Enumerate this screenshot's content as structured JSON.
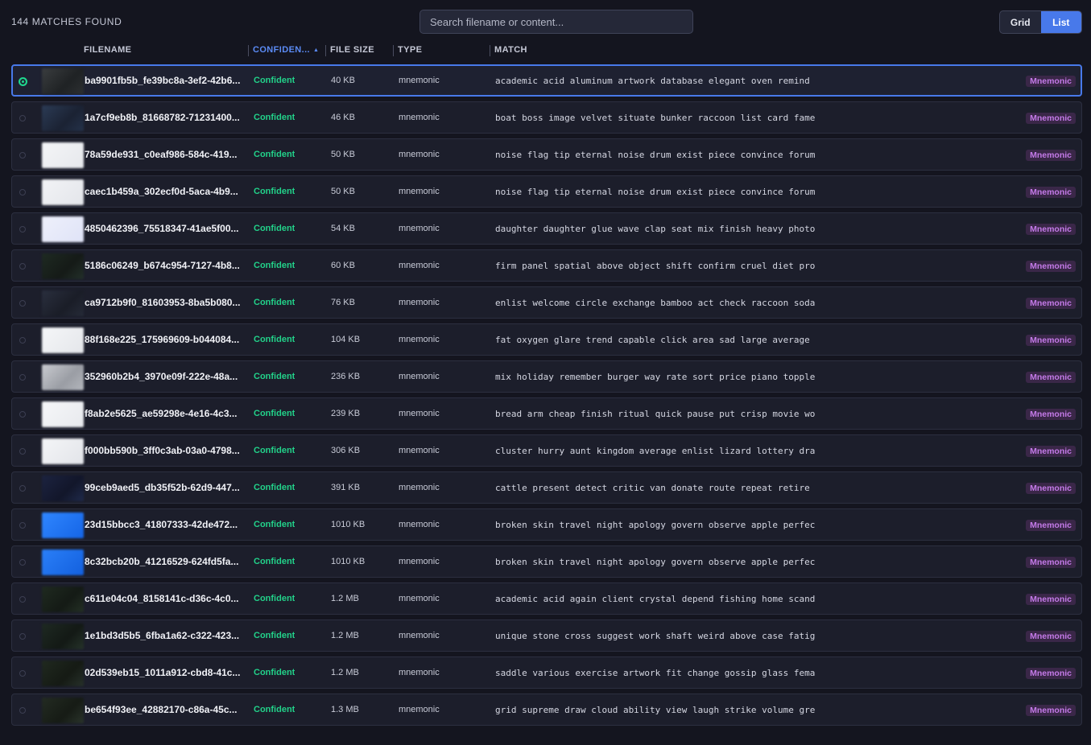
{
  "header": {
    "matches_found": "144 MATCHES FOUND",
    "search_placeholder": "Search filename or content...",
    "view_grid": "Grid",
    "view_list": "List",
    "active_view": "List"
  },
  "columns": {
    "filename": "FILENAME",
    "confidence": "CONFIDEN...",
    "file_size": "FILE SIZE",
    "type": "TYPE",
    "match": "MATCH"
  },
  "colors": {
    "accent": "#4879ea",
    "confident": "#22d28a",
    "badge_bg": "#3a2748",
    "badge_text": "#c47ae8"
  },
  "rows": [
    {
      "filename": "ba9901fb5b_fe39bc8a-3ef2-42b6...",
      "confidence": "Confident",
      "size": "40 KB",
      "type": "mnemonic",
      "match": "academic acid aluminum artwork database elegant oven remind",
      "badge": "Mnemonic",
      "selected": true
    },
    {
      "filename": "1a7cf9eb8b_81668782-71231400...",
      "confidence": "Confident",
      "size": "46 KB",
      "type": "mnemonic",
      "match": "boat boss image velvet situate bunker raccoon list card fame",
      "badge": "Mnemonic"
    },
    {
      "filename": "78a59de931_c0eaf986-584c-419...",
      "confidence": "Confident",
      "size": "50 KB",
      "type": "mnemonic",
      "match": "noise flag tip eternal noise drum exist piece convince forum",
      "badge": "Mnemonic"
    },
    {
      "filename": "caec1b459a_302ecf0d-5aca-4b9...",
      "confidence": "Confident",
      "size": "50 KB",
      "type": "mnemonic",
      "match": "noise flag tip eternal noise drum exist piece convince forum",
      "badge": "Mnemonic"
    },
    {
      "filename": "4850462396_75518347-41ae5f00...",
      "confidence": "Confident",
      "size": "54 KB",
      "type": "mnemonic",
      "match": "daughter daughter glue wave clap seat mix finish heavy photo",
      "badge": "Mnemonic"
    },
    {
      "filename": "5186c06249_b674c954-7127-4b8...",
      "confidence": "Confident",
      "size": "60 KB",
      "type": "mnemonic",
      "match": "firm panel spatial above object shift confirm cruel diet pro",
      "badge": "Mnemonic"
    },
    {
      "filename": "ca9712b9f0_81603953-8ba5b080...",
      "confidence": "Confident",
      "size": "76 KB",
      "type": "mnemonic",
      "match": "enlist welcome circle exchange bamboo act check raccoon soda",
      "badge": "Mnemonic"
    },
    {
      "filename": "88f168e225_175969609-b044084...",
      "confidence": "Confident",
      "size": "104 KB",
      "type": "mnemonic",
      "match": "fat oxygen glare trend capable click area sad large average",
      "badge": "Mnemonic"
    },
    {
      "filename": "352960b2b4_3970e09f-222e-48a...",
      "confidence": "Confident",
      "size": "236 KB",
      "type": "mnemonic",
      "match": "mix holiday remember burger way rate sort price piano topple",
      "badge": "Mnemonic"
    },
    {
      "filename": "f8ab2e5625_ae59298e-4e16-4c3...",
      "confidence": "Confident",
      "size": "239 KB",
      "type": "mnemonic",
      "match": "bread arm cheap finish ritual quick pause put crisp movie wo",
      "badge": "Mnemonic"
    },
    {
      "filename": "f000bb590b_3ff0c3ab-03a0-4798...",
      "confidence": "Confident",
      "size": "306 KB",
      "type": "mnemonic",
      "match": "cluster hurry aunt kingdom average enlist lizard lottery dra",
      "badge": "Mnemonic"
    },
    {
      "filename": "99ceb9aed5_db35f52b-62d9-447...",
      "confidence": "Confident",
      "size": "391 KB",
      "type": "mnemonic",
      "match": "cattle present detect critic van donate route repeat retire",
      "badge": "Mnemonic"
    },
    {
      "filename": "23d15bbcc3_41807333-42de472...",
      "confidence": "Confident",
      "size": "1010 KB",
      "type": "mnemonic",
      "match": "broken skin travel night apology govern observe apple perfec",
      "badge": "Mnemonic"
    },
    {
      "filename": "8c32bcb20b_41216529-624fd5fa...",
      "confidence": "Confident",
      "size": "1010 KB",
      "type": "mnemonic",
      "match": "broken skin travel night apology govern observe apple perfec",
      "badge": "Mnemonic"
    },
    {
      "filename": "c611e04c04_8158141c-d36c-4c0...",
      "confidence": "Confident",
      "size": "1.2 MB",
      "type": "mnemonic",
      "match": "academic acid again client crystal depend fishing home scand",
      "badge": "Mnemonic"
    },
    {
      "filename": "1e1bd3d5b5_6fba1a62-c322-423...",
      "confidence": "Confident",
      "size": "1.2 MB",
      "type": "mnemonic",
      "match": "unique stone cross suggest work shaft weird above case fatig",
      "badge": "Mnemonic"
    },
    {
      "filename": "02d539eb15_1011a912-cbd8-41c...",
      "confidence": "Confident",
      "size": "1.2 MB",
      "type": "mnemonic",
      "match": "saddle various exercise artwork fit change gossip glass fema",
      "badge": "Mnemonic"
    },
    {
      "filename": "be654f93ee_42882170-c86a-45c...",
      "confidence": "Confident",
      "size": "1.3 MB",
      "type": "mnemonic",
      "match": "grid supreme draw cloud ability view laugh strike volume gre",
      "badge": "Mnemonic"
    }
  ]
}
